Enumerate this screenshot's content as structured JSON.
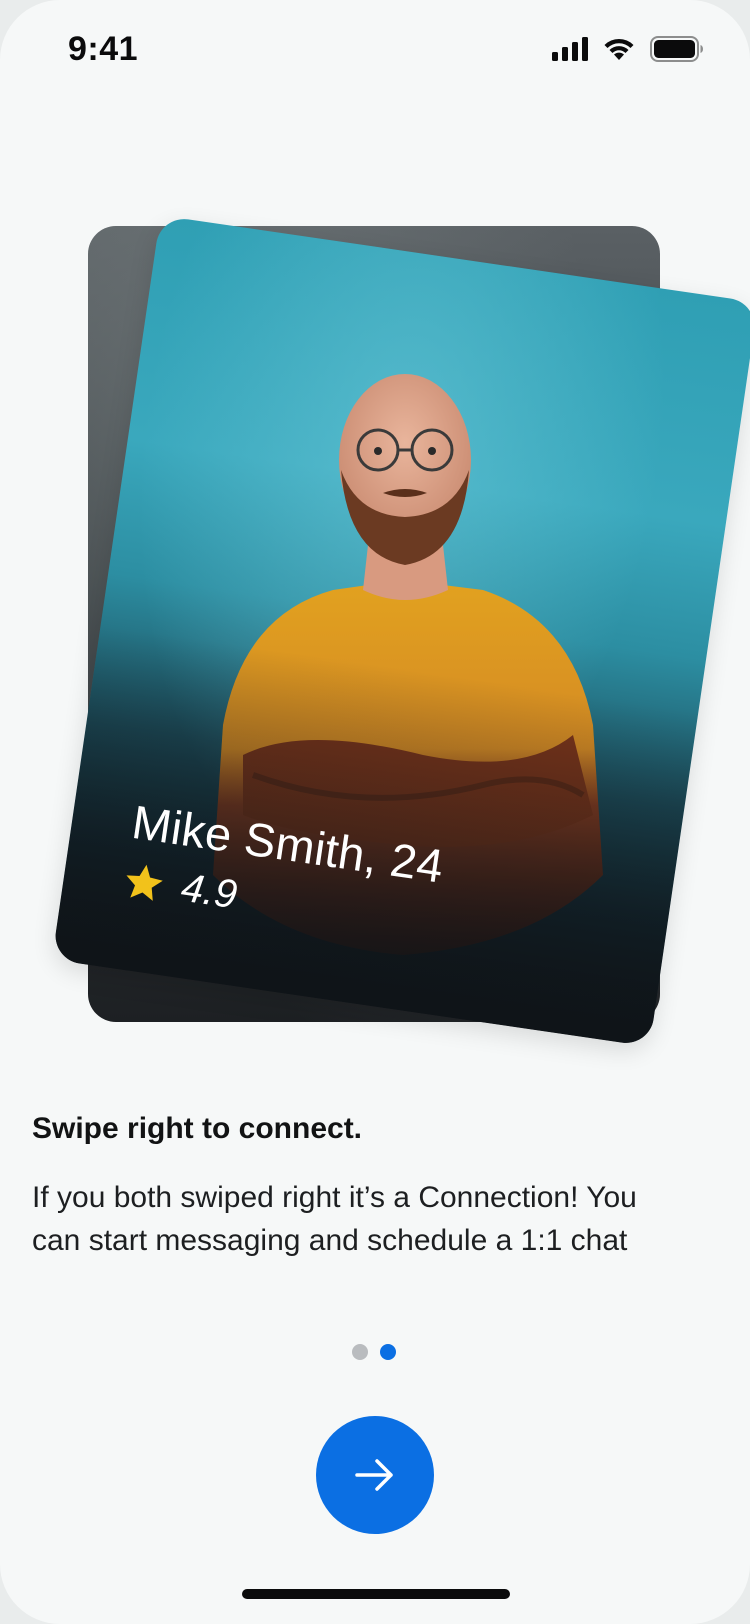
{
  "status_bar": {
    "time": "9:41",
    "icons": [
      "cellular-signal-icon",
      "wifi-icon",
      "battery-icon"
    ]
  },
  "profile_card": {
    "name": "Mike Smith, 24",
    "rating": "4.9",
    "rating_icon": "star-icon",
    "star_color": "#F2C21B"
  },
  "onboarding": {
    "headline": "Swipe right to connect.",
    "description": "If you both swiped right it’s a Connection! You\ncan  start messaging and schedule a 1:1 chat",
    "page_count": 2,
    "active_page": 2
  },
  "next_button": {
    "icon": "arrow-right-icon",
    "color": "#0B6FE3"
  }
}
